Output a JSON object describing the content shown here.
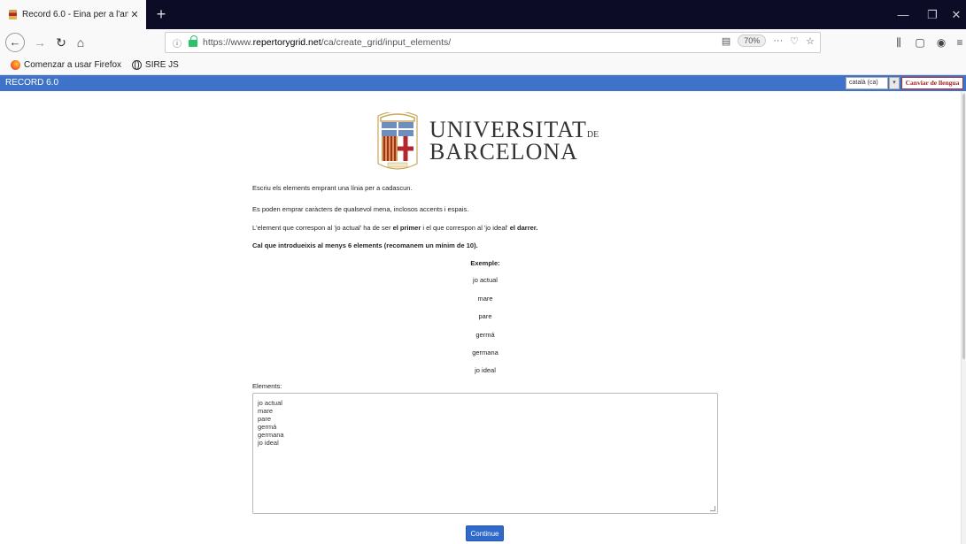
{
  "browser": {
    "tab_title": "Record 6.0 - Eina per a l'anàlisi",
    "tab_close": "✕",
    "new_tab": "+",
    "url": {
      "prefix": "https://www.",
      "domain": "repertorygrid.net",
      "path": "/ca/create_grid/input_elements/"
    },
    "zoom": "70%",
    "bookmarks": [
      {
        "label": "Comenzar a usar Firefox",
        "icon": "firefox-icon"
      },
      {
        "label": "SIRE JS",
        "icon": "globe-icon"
      }
    ]
  },
  "app": {
    "brand": "RECORD 6.0",
    "language_selected": "català (ca)",
    "change_language_button": "Canviar de llengua"
  },
  "logo": {
    "line1": "UNIVERSITAT",
    "line1_suffix": "DE",
    "line2": "BARCELONA"
  },
  "instructions": {
    "p1": "Escriu els elements emprant una línia per a cadascun.",
    "p2": "Es poden emprar caràcters de qualsevol mena, inclosos accents i espais.",
    "p3_a": "L'element que correspon al 'jo actual' ha de ser ",
    "p3_b": "el primer",
    "p3_c": " i el que correspon al 'jo ideal' ",
    "p3_d": "el darrer.",
    "p4": "Cal que introdueixis al menys 6 elements (recomanem un mínim de 10)."
  },
  "example": {
    "title": "Exemple:",
    "items": [
      "jo actual",
      "mare",
      "pare",
      "germá",
      "germana",
      "jo ideal"
    ]
  },
  "form": {
    "elements_label": "Elements:",
    "textarea_lines": [
      "jo actual",
      "mare",
      "pare",
      "germá",
      "germana",
      "jo ideal"
    ],
    "continue_button": "Continue"
  },
  "colors": {
    "appbar": "#3f72c9",
    "continue": "#2f69c9",
    "tabbar": "#0c0c27"
  }
}
